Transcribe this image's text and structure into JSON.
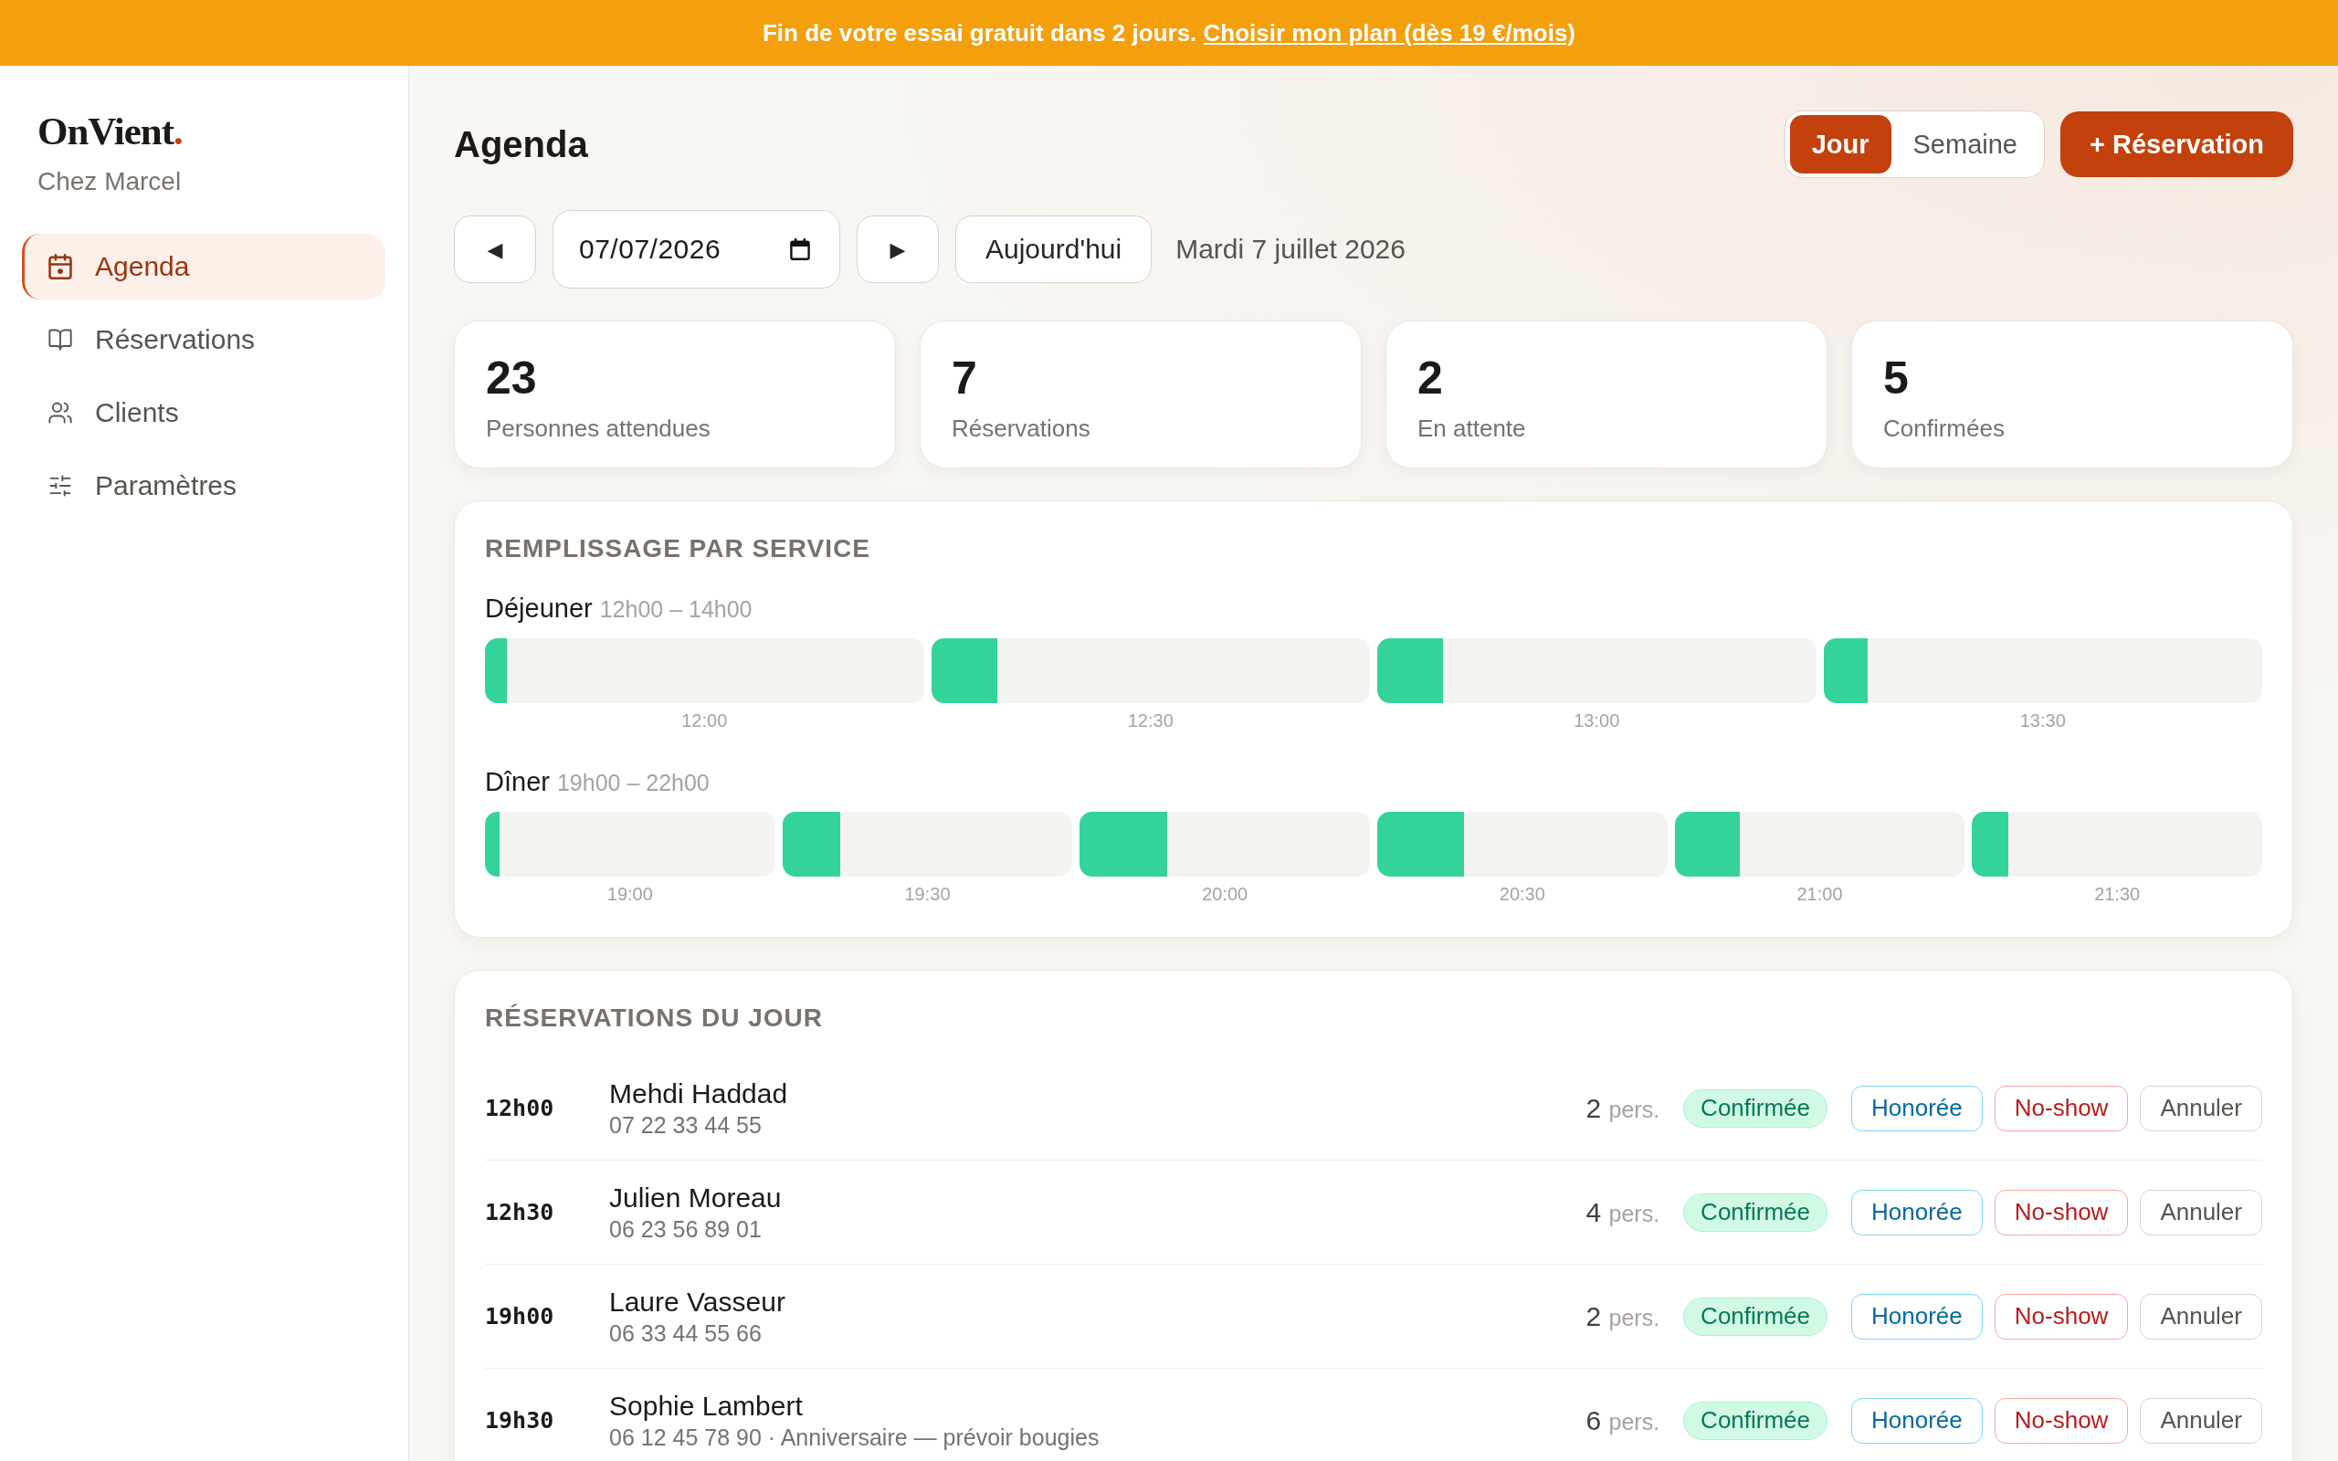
{
  "banner": {
    "message": "Fin de votre essai gratuit dans 2 jours.",
    "link": "Choisir mon plan (dès 19 €/mois)"
  },
  "sidebar": {
    "brand": {
      "name": "OnVient",
      "accent": "."
    },
    "restaurant": "Chez Marcel",
    "items": [
      {
        "label": "Agenda",
        "selected": true
      },
      {
        "label": "Réservations",
        "selected": false
      },
      {
        "label": "Clients",
        "selected": false
      },
      {
        "label": "Paramètres",
        "selected": false
      }
    ]
  },
  "header": {
    "title": "Agenda",
    "view_toggle": [
      {
        "label": "Jour",
        "selected": true
      },
      {
        "label": "Semaine",
        "selected": false
      }
    ],
    "new_button": "+ Réservation"
  },
  "date_nav": {
    "prev": "◀",
    "date": "07/07/2026",
    "next": "▶",
    "today": "Aujourd'hui",
    "date_label": "Mardi 7 juillet 2026"
  },
  "stats": [
    {
      "value": "23",
      "label": "Personnes attendues"
    },
    {
      "value": "7",
      "label": "Réservations"
    },
    {
      "value": "2",
      "label": "En attente"
    },
    {
      "value": "5",
      "label": "Confirmées"
    }
  ],
  "occupancy": {
    "title": "REMPLISSAGE PAR SERVICE",
    "services": [
      {
        "name": "Déjeuner",
        "hours": "12h00 – 14h00",
        "slots": [
          {
            "time": "12:00",
            "level": 0.05
          },
          {
            "time": "12:30",
            "level": 0.15
          },
          {
            "time": "13:00",
            "level": 0.15
          },
          {
            "time": "13:30",
            "level": 0.1
          }
        ]
      },
      {
        "name": "Dîner",
        "hours": "19h00 – 22h00",
        "slots": [
          {
            "time": "19:00",
            "level": 0.05
          },
          {
            "time": "19:30",
            "level": 0.2
          },
          {
            "time": "20:00",
            "level": 0.3
          },
          {
            "time": "20:30",
            "level": 0.3
          },
          {
            "time": "21:00",
            "level": 0.225
          },
          {
            "time": "21:30",
            "level": 0.125
          }
        ]
      }
    ]
  },
  "reservations": {
    "title": "RÉSERVATIONS DU JOUR",
    "rows": [
      {
        "time": "12h00",
        "name": "Mehdi Haddad",
        "contact": "07 22 33 44 55",
        "party": "2",
        "party_unit": "pers.",
        "status": "Confirmée",
        "actions": [
          {
            "label": "Honorée",
            "kind": "honor"
          },
          {
            "label": "No-show",
            "kind": "noshow"
          },
          {
            "label": "Annuler",
            "kind": "cancel"
          }
        ]
      },
      {
        "time": "12h30",
        "name": "Julien Moreau",
        "contact": "06 23 56 89 01",
        "party": "4",
        "party_unit": "pers.",
        "status": "Confirmée",
        "actions": [
          {
            "label": "Honorée",
            "kind": "honor"
          },
          {
            "label": "No-show",
            "kind": "noshow"
          },
          {
            "label": "Annuler",
            "kind": "cancel"
          }
        ]
      },
      {
        "time": "19h00",
        "name": "Laure Vasseur",
        "contact": "06 33 44 55 66",
        "party": "2",
        "party_unit": "pers.",
        "status": "Confirmée",
        "actions": [
          {
            "label": "Honorée",
            "kind": "honor"
          },
          {
            "label": "No-show",
            "kind": "noshow"
          },
          {
            "label": "Annuler",
            "kind": "cancel"
          }
        ]
      },
      {
        "time": "19h30",
        "name": "Sophie Lambert",
        "contact": "06 12 45 78 90 · Anniversaire — prévoir bougies",
        "party": "6",
        "party_unit": "pers.",
        "status": "Confirmée",
        "actions": [
          {
            "label": "Honorée",
            "kind": "honor"
          },
          {
            "label": "No-show",
            "kind": "noshow"
          },
          {
            "label": "Annuler",
            "kind": "cancel"
          }
        ]
      }
    ]
  }
}
